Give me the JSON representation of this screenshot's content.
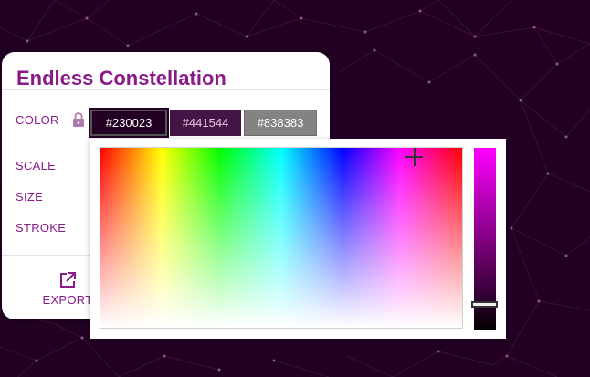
{
  "app": {
    "title": "Endless Constellation"
  },
  "colors": {
    "background": "#230023",
    "accent": "#8a1a8a",
    "panel": "#ffffff"
  },
  "controls": {
    "color_label": "COLOR",
    "scale_label": "SCALE",
    "size_label": "SIZE",
    "stroke_label": "STROKE",
    "lock_icon": "lock-icon"
  },
  "swatches": [
    {
      "label": "#230023",
      "color": "#230023"
    },
    {
      "label": "#441544",
      "color": "#441544"
    },
    {
      "label": "#838383",
      "color": "#838383"
    }
  ],
  "export": {
    "label": "EXPORT",
    "icon": "external-link-icon"
  },
  "picker": {
    "hue_spectrum": [
      "#ff0000",
      "#ffff00",
      "#00ff00",
      "#00ffff",
      "#0000ff",
      "#ff00ff",
      "#ff0000"
    ],
    "value_bar": [
      "#ff00ff",
      "#230023",
      "#000000"
    ]
  }
}
